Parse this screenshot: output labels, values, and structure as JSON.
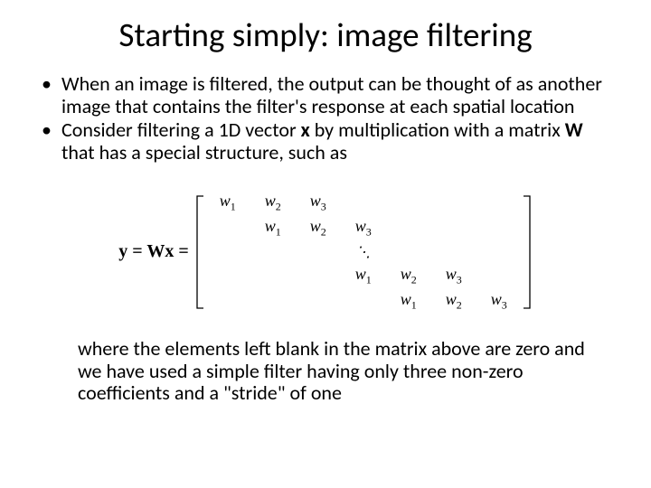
{
  "title": "Starting simply: image filtering",
  "bullets": [
    "When an image is filtered, the output can be thought of as another image that contains the filter's response at each spatial location",
    "Consider filtering a 1D vector x by multiplication with a matrix W that has a special structure, such as"
  ],
  "equation": {
    "lhs": "y = Wx =",
    "entries": {
      "w1": "w",
      "s1": "1",
      "w2": "w",
      "s2": "2",
      "w3": "w",
      "s3": "3"
    },
    "ddots": "⋱"
  },
  "closing": "where the elements left blank in the matrix above are zero and we have used a simple filter having only three non-zero coefficients and a \"stride\" of one"
}
